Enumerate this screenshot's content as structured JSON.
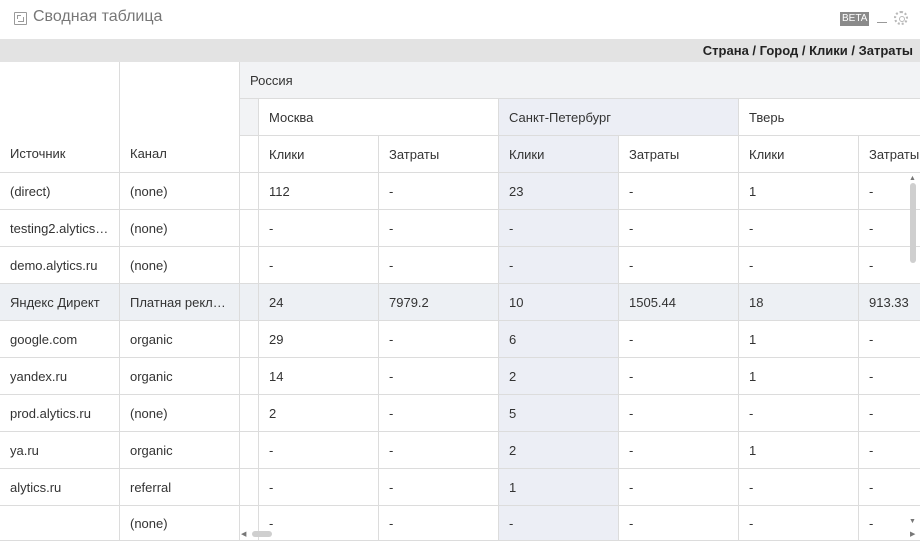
{
  "window": {
    "title": "Сводная таблица",
    "badge": "BETA",
    "title_icon": "pivot-table-icon",
    "settings_icon": "gear-icon",
    "minimize_icon": "minimize-icon"
  },
  "dimensions_bar": "Страна / Город / Клики / Затраты",
  "table": {
    "row_headers": [
      "Источник",
      "Канал"
    ],
    "country": "Россия",
    "cities": [
      "Москва",
      "Санкт-Петербург",
      "Тверь"
    ],
    "metrics": [
      "Клики",
      "Затраты"
    ],
    "rows": [
      {
        "source": "(direct)",
        "channel": "(none)",
        "values": [
          "112",
          "-",
          "23",
          "-",
          "1",
          "-"
        ]
      },
      {
        "source": "testing2.alytics…",
        "channel": "(none)",
        "values": [
          "-",
          "-",
          "-",
          "-",
          "-",
          "-"
        ]
      },
      {
        "source": "demo.alytics.ru",
        "channel": "(none)",
        "values": [
          "-",
          "-",
          "-",
          "-",
          "-",
          "-"
        ]
      },
      {
        "source": "Яндекс Директ",
        "channel": "Платная рекл…",
        "values": [
          "24",
          "7979.2",
          "10",
          "1505.44",
          "18",
          "913.33"
        ]
      },
      {
        "source": "google.com",
        "channel": "organic",
        "values": [
          "29",
          "-",
          "6",
          "-",
          "1",
          "-"
        ]
      },
      {
        "source": "yandex.ru",
        "channel": "organic",
        "values": [
          "14",
          "-",
          "2",
          "-",
          "1",
          "-"
        ]
      },
      {
        "source": "prod.alytics.ru",
        "channel": "(none)",
        "values": [
          "2",
          "-",
          "5",
          "-",
          "-",
          "-"
        ]
      },
      {
        "source": "ya.ru",
        "channel": "organic",
        "values": [
          "-",
          "-",
          "2",
          "-",
          "1",
          "-"
        ]
      },
      {
        "source": "alytics.ru",
        "channel": "referral",
        "values": [
          "-",
          "-",
          "1",
          "-",
          "-",
          "-"
        ]
      },
      {
        "source": "",
        "channel": "(none)",
        "values": [
          "-",
          "-",
          "-",
          "-",
          "-",
          "-"
        ]
      }
    ]
  },
  "colors": {
    "header_bg": "#f2f3f5",
    "highlight_row": "#edf0f4",
    "dim_bar": "#e3e3e3",
    "text": "#333333"
  }
}
